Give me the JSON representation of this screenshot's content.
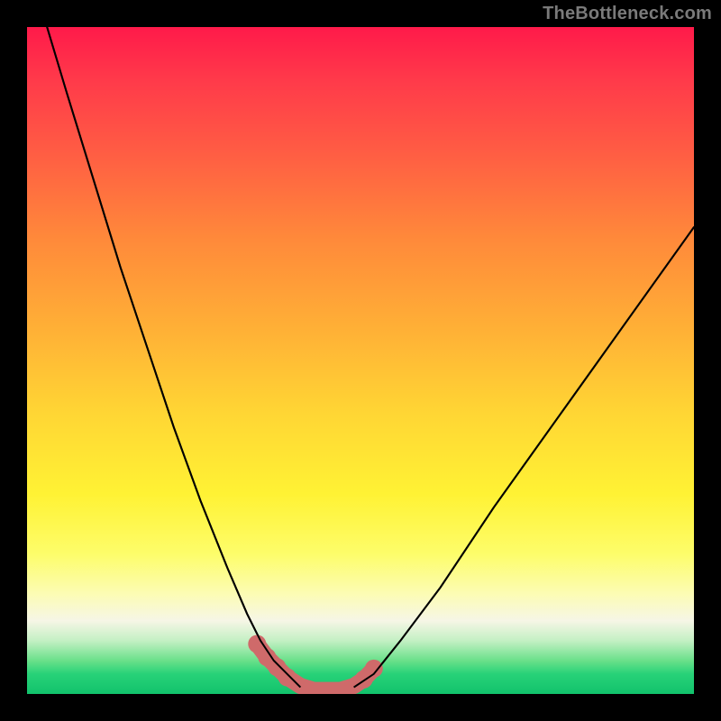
{
  "watermark": "TheBottleneck.com",
  "colors": {
    "background": "#000000",
    "gradient_top": "#ff1a4a",
    "gradient_mid": "#fff234",
    "gradient_bottom": "#12c26c",
    "curve": "#000000",
    "marker": "#cf6a6a"
  },
  "chart_data": {
    "type": "line",
    "title": "",
    "xlabel": "",
    "ylabel": "",
    "xlim": [
      0,
      100
    ],
    "ylim": [
      0,
      100
    ],
    "series": [
      {
        "name": "left-curve",
        "x": [
          3,
          6,
          10,
          14,
          18,
          22,
          26,
          30,
          33,
          35,
          37,
          39,
          41
        ],
        "y": [
          100,
          90,
          77,
          64,
          52,
          40,
          29,
          19,
          12,
          8,
          5,
          3,
          1
        ]
      },
      {
        "name": "right-curve",
        "x": [
          49,
          52,
          56,
          62,
          70,
          80,
          90,
          100
        ],
        "y": [
          1,
          3,
          8,
          16,
          28,
          42,
          56,
          70
        ]
      },
      {
        "name": "floor",
        "x": [
          41,
          43,
          45,
          47,
          49
        ],
        "y": [
          1,
          0,
          0,
          0,
          1
        ]
      }
    ],
    "markers": {
      "name": "bottom-dots",
      "x": [
        34.5,
        36,
        37.5,
        39,
        41,
        43,
        45,
        47,
        49,
        50.5,
        52
      ],
      "y": [
        7.5,
        5.5,
        4,
        2.5,
        1.2,
        0.6,
        0.6,
        0.6,
        1.2,
        2.2,
        3.8
      ]
    }
  }
}
